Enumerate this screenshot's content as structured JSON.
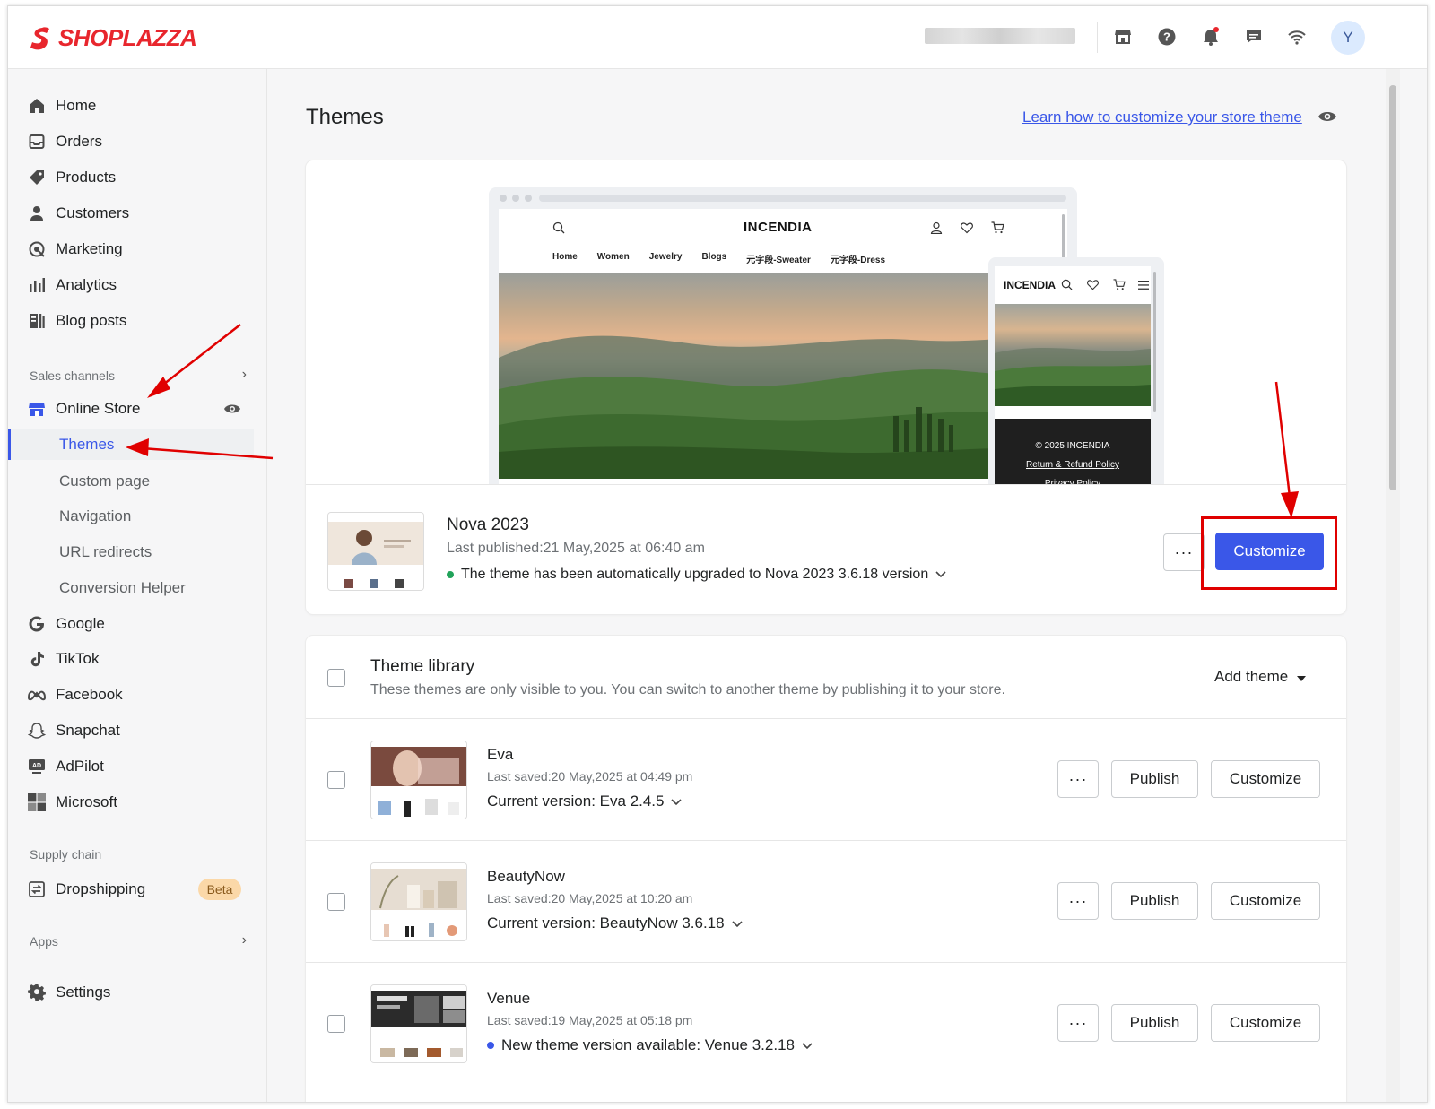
{
  "app": {
    "brand": "SHOPLAZZA",
    "avatar_initial": "Y"
  },
  "topbar": {
    "icons": [
      "storefront-icon",
      "help-icon",
      "bell-icon",
      "chat-icon",
      "wifi-icon"
    ],
    "notification_dot_color": "#e8262d"
  },
  "sidebar": {
    "items": [
      {
        "label": "Home",
        "icon": "home-icon"
      },
      {
        "label": "Orders",
        "icon": "orders-icon"
      },
      {
        "label": "Products",
        "icon": "tag-icon"
      },
      {
        "label": "Customers",
        "icon": "person-icon"
      },
      {
        "label": "Marketing",
        "icon": "marketing-icon"
      },
      {
        "label": "Analytics",
        "icon": "bar-chart-icon"
      },
      {
        "label": "Blog posts",
        "icon": "blog-icon"
      }
    ],
    "sales_channels_label": "Sales channels",
    "online_store_label": "Online Store",
    "online_store_sub": [
      "Themes",
      "Custom page",
      "Navigation",
      "URL redirects",
      "Conversion Helper"
    ],
    "channels": [
      {
        "label": "Google",
        "icon": "google-icon"
      },
      {
        "label": "TikTok",
        "icon": "tiktok-icon"
      },
      {
        "label": "Facebook",
        "icon": "meta-icon"
      },
      {
        "label": "Snapchat",
        "icon": "snapchat-icon"
      },
      {
        "label": "AdPilot",
        "icon": "adpilot-icon"
      },
      {
        "label": "Microsoft",
        "icon": "microsoft-icon"
      }
    ],
    "supply_chain_label": "Supply chain",
    "dropshipping_label": "Dropshipping",
    "beta_label": "Beta",
    "apps_label": "Apps",
    "settings_label": "Settings"
  },
  "main": {
    "title": "Themes",
    "learn_link": "Learn how to customize your store theme",
    "preview": {
      "brand": "INCENDIA",
      "menu": [
        "Home",
        "Women",
        "Jewelry",
        "Blogs",
        "元字段-Sweater",
        "元字段-Dress"
      ],
      "mobile_brand": "INCENDIA",
      "footer_copy": "© 2025 INCENDIA",
      "footer_refund": "Return & Refund Policy",
      "footer_privacy": "Privacy Policy"
    },
    "current_theme": {
      "name": "Nova 2023",
      "published": "Last published:21 May,2025 at 06:40 am",
      "upgrade_note": "The theme has been automatically upgraded to Nova 2023 3.6.18 version",
      "more_label": "···",
      "customize_label": "Customize"
    },
    "library": {
      "title": "Theme library",
      "description": "These themes are only visible to you. You can switch to another theme by publishing it to your store.",
      "add_theme_label": "Add theme",
      "publish_label": "Publish",
      "customize_label": "Customize",
      "more_label": "···",
      "themes": [
        {
          "name": "Eva",
          "saved": "Last saved:20 May,2025 at 04:49 pm",
          "version": "Current version: Eva 2.4.5"
        },
        {
          "name": "BeautyNow",
          "saved": "Last saved:20 May,2025 at 10:20 am",
          "version": "Current version: BeautyNow 3.6.18"
        },
        {
          "name": "Venue",
          "saved": "Last saved:19 May,2025 at 05:18 pm",
          "version": "New theme version available: Venue 3.2.18"
        }
      ]
    }
  },
  "colors": {
    "accent": "#3a57e8",
    "success_dot": "#21a35a",
    "info_dot": "#3a57e8",
    "annotation": "#e00000"
  }
}
